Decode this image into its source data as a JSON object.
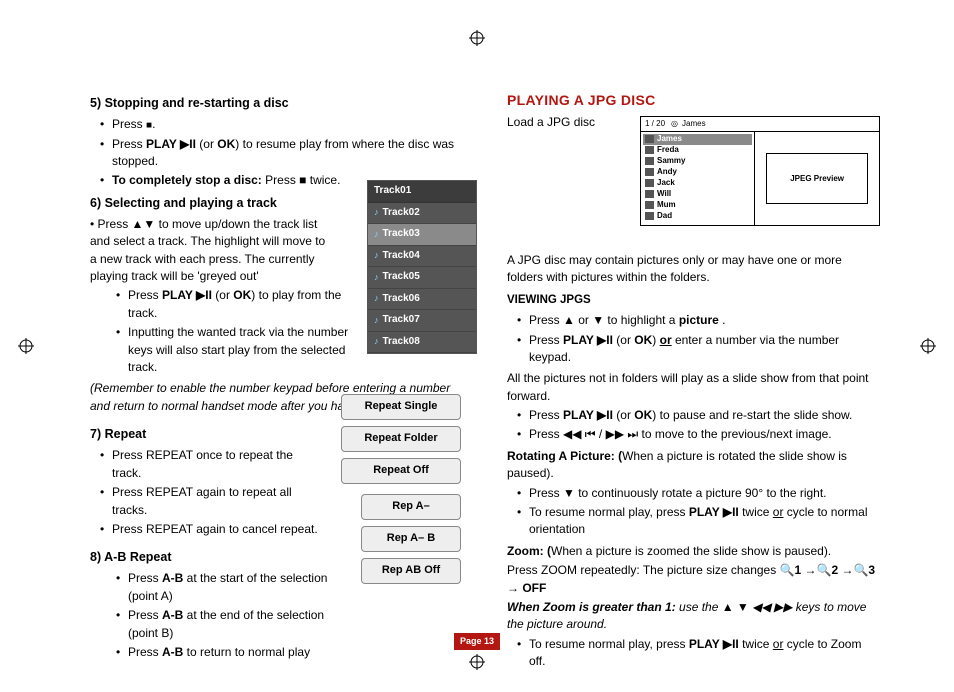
{
  "left": {
    "s5": {
      "heading": "5)  Stopping  and re-starting a disc",
      "b1_a": "Press ",
      "b1_b": ".",
      "b2_a": "Press ",
      "b2_play": "PLAY  ▶II",
      "b2_c": " (or ",
      "b2_ok": "OK",
      "b2_e": ") to resume play from where the disc was stopped.",
      "b3_lead": "To completely stop a disc:",
      "b3_tail": " Press ■ twice."
    },
    "s6": {
      "heading": "6)  Selecting and playing a track",
      "p1": "• Press ▲▼ to  move up/down the track list and select a track. The highlight will move  to a new track with each press. The currently playing track will be  'greyed out'",
      "b1_a": "Press ",
      "b1_play": "PLAY  ▶II",
      "b1_c": " (or ",
      "b1_ok": "OK",
      "b1_e": ")  to play from the track.",
      "b2": "Inputting the wanted track via the number keys will also start play from the selected track.",
      "note": "(Remember to enable the number keypad before entering a number and return to normal handset mode after you have finished)"
    },
    "s7": {
      "heading": "7)  Repeat",
      "b1": "Press REPEAT once to repeat the track.",
      "b2": "Press REPEAT again to repeat all tracks.",
      "b3": "Press REPEAT again to cancel repeat."
    },
    "s8": {
      "heading_a": "8)  ",
      "heading_b": "A-B Repeat",
      "b1_a": "Press ",
      "b1_b": "A-B",
      "b1_c": " at the start of the selection (point A)",
      "b2_a": "Press ",
      "b2_b": "A-B",
      "b2_c": " at the end of the selection (point B)",
      "b3_a": "Press ",
      "b3_b": "A-B",
      "b3_c": " to return to normal play"
    },
    "tracks": [
      "Track01",
      "Track02",
      "Track03",
      "Track04",
      "Track05",
      "Track06",
      "Track07",
      "Track08"
    ],
    "repeat_pills": [
      "Repeat Single",
      "Repeat Folder",
      "Repeat Off"
    ],
    "ab_pills": [
      "Rep A–",
      "Rep A– B",
      "Rep AB Off"
    ]
  },
  "right": {
    "title": "PLAYING A JPG DISC",
    "load": "Load a JPG  disc",
    "jpgui": {
      "counter": "1  /    20",
      "current": "James",
      "preview_label": "JPEG Preview",
      "items": [
        "James",
        "Freda",
        "Sammy",
        "Andy",
        "Jack",
        "Will",
        "Mum",
        "Dad"
      ]
    },
    "intro": "A JPG disc may contain pictures only or may have one or more folders with pictures within the folders.",
    "viewing_h": "VIEWING JPGS",
    "v_b1_a": "Press ▲ or ▼ to highlight a ",
    "v_b1_b": "picture",
    "v_b1_c": " .",
    "v_b2_a": "Press ",
    "v_b2_play": "PLAY  ▶II",
    "v_b2_c": " (or ",
    "v_b2_ok": "OK",
    "v_b2_e": ")  ",
    "v_b2_or": "or",
    "v_b2_f": " enter a number via the number keypad.",
    "v_p": "All the pictures not in folders will play as a slide show from that point forward.",
    "v_b3_a": "Press ",
    "v_b3_play": "PLAY  ▶II",
    "v_b3_c": " (or ",
    "v_b3_ok": "OK",
    "v_b3_e": ") to pause and re-start the slide show.",
    "v_b4": "Press  ◀◀ ⏮ / ▶▶ ⏭   to move to the previous/next image.",
    "rot_h": "Rotating A Picture:  (",
    "rot_t": "When a picture is rotated the slide show is paused).",
    "rot_b1": "Press ▼ to continuously rotate a picture 90° to the right.",
    "rot_b2_a": "To resume normal play, press ",
    "rot_b2_play": "PLAY  ▶II",
    "rot_b2_c": " twice ",
    "rot_b2_or": "or",
    "rot_b2_e": " cycle to normal orientation",
    "zoom_h": "Zoom:  (",
    "zoom_t": "When a picture is zoomed the slide show is paused).",
    "zoom_seq_a": "Press ZOOM repeatedly: The picture size changes    ",
    "zoom_seq_b": "🔍1 →🔍2 →🔍3  → OFF",
    "zoom_gt_a": "When Zoom is greater than 1:",
    "zoom_gt_b": " use the  ▲ ▼ ◀◀ ▶▶ keys  to move the picture around.",
    "zoom_end_a": "To resume normal play, press ",
    "zoom_end_play": "PLAY  ▶II",
    "zoom_end_c": " twice ",
    "zoom_end_or": "or",
    "zoom_end_e": " cycle to Zoom off."
  },
  "page_label": "Page 13"
}
